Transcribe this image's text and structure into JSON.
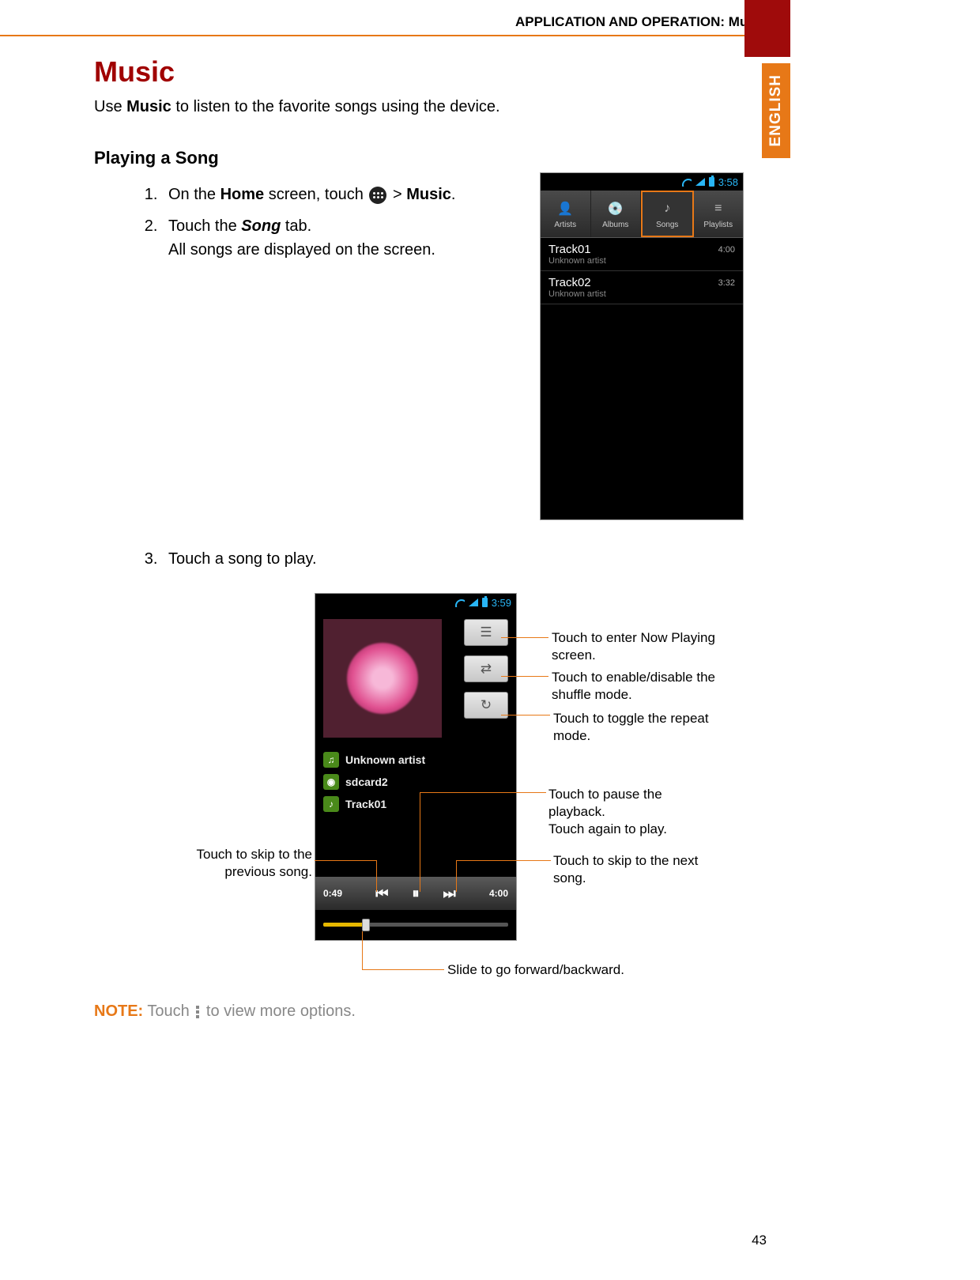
{
  "header": {
    "section": "APPLICATION AND OPERATION: Music"
  },
  "sidetab": {
    "language": "ENGLISH"
  },
  "page": {
    "title": "Music",
    "intro_pre": "Use ",
    "intro_bold": "Music",
    "intro_post": " to listen to the favorite songs using the device.",
    "subhead": "Playing a Song",
    "steps": {
      "s1_pre": "On the ",
      "s1_b1": "Home",
      "s1_mid": " screen, touch ",
      "s1_gt": " > ",
      "s1_b2": "Music",
      "s1_post": ".",
      "s2_pre": "Touch the ",
      "s2_bi": "Song",
      "s2_post": " tab.",
      "s2_l2": "All songs are displayed on the screen.",
      "s3": "Touch a song to play."
    },
    "note_label": "NOTE:",
    "note_pre": " Touch ",
    "note_post": " to view more options.",
    "number": "43"
  },
  "shot1": {
    "time": "3:58",
    "tabs": [
      "Artists",
      "Albums",
      "Songs",
      "Playlists"
    ],
    "tracks": [
      {
        "name": "Track01",
        "artist": "Unknown artist",
        "dur": "4:00"
      },
      {
        "name": "Track02",
        "artist": "Unknown artist",
        "dur": "3:32"
      }
    ]
  },
  "shot2": {
    "time": "3:59",
    "artist": "Unknown artist",
    "album": "sdcard2",
    "track": "Track01",
    "elapsed": "0:49",
    "total": "4:00"
  },
  "callouts": {
    "nowplaying": "Touch to enter Now Playing screen.",
    "shuffle": "Touch to enable/disable the shuffle mode.",
    "repeat": "Touch to toggle the repeat mode.",
    "pause_l1": "Touch to pause the playback.",
    "pause_l2": "Touch again to play.",
    "next": "Touch to skip to the next song.",
    "prev": "Touch to skip to the previous song.",
    "slider": "Slide to go forward/backward."
  }
}
